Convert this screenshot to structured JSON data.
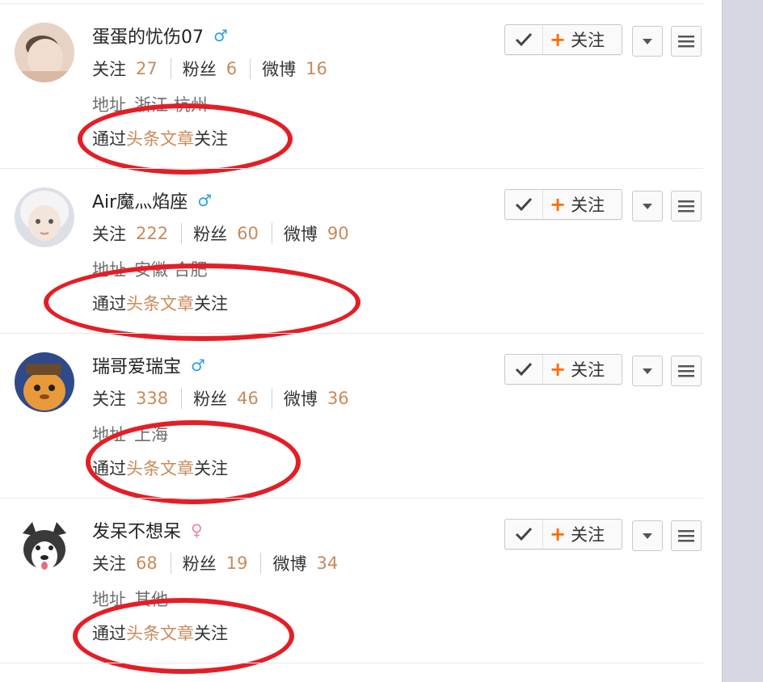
{
  "colors": {
    "accent_orange": "#ff6a00",
    "count_color": "#c98a5a",
    "annotation_red": "#e41e26",
    "male_blue": "#2f9fe0",
    "female_pink": "#e88a9e"
  },
  "labels": {
    "following": "关注",
    "fans": "粉丝",
    "weibo": "微博",
    "follow_button": "关注",
    "address_prefix": "地址"
  },
  "users": [
    {
      "name": "蛋蛋的忧伤07",
      "gender": "male",
      "gender_symbol": "♂",
      "following": "27",
      "fans": "6",
      "weibo": "16",
      "address": "浙江 杭州",
      "source_prefix": "通过",
      "source_link": "头条文章",
      "source_suffix": "关注"
    },
    {
      "name": "Air魔灬焰座",
      "gender": "male",
      "gender_symbol": "♂",
      "following": "222",
      "fans": "60",
      "weibo": "90",
      "address": "安徽 合肥",
      "source_prefix": "通过",
      "source_link": "头条文章",
      "source_suffix": "关注"
    },
    {
      "name": "瑞哥爱瑞宝",
      "gender": "male",
      "gender_symbol": "♂",
      "following": "338",
      "fans": "46",
      "weibo": "36",
      "address": "上海",
      "source_prefix": "通过",
      "source_link": "头条文章",
      "source_suffix": "关注"
    },
    {
      "name": "发呆不想呆",
      "gender": "female",
      "gender_symbol": "♀",
      "following": "68",
      "fans": "19",
      "weibo": "34",
      "address": "其他",
      "source_prefix": "通过",
      "source_link": "头条文章",
      "source_suffix": "关注"
    }
  ]
}
